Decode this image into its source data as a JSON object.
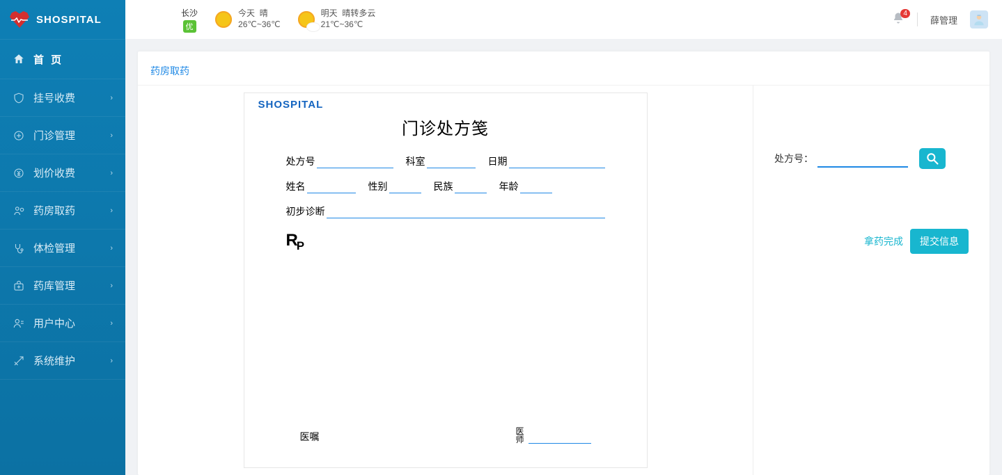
{
  "brand": "SHOSPITAL",
  "sidebar": {
    "home": "首 页",
    "items": [
      {
        "icon": "shield-icon",
        "label": "挂号收费"
      },
      {
        "icon": "plus-icon",
        "label": "门诊管理"
      },
      {
        "icon": "yuan-icon",
        "label": "划价收费"
      },
      {
        "icon": "pharmacy-icon",
        "label": "药房取药"
      },
      {
        "icon": "stethoscope-icon",
        "label": "体检管理"
      },
      {
        "icon": "medkit-icon",
        "label": "药库管理"
      },
      {
        "icon": "user-icon",
        "label": "用户中心"
      },
      {
        "icon": "tools-icon",
        "label": "系统维护"
      }
    ]
  },
  "header": {
    "city": "长沙",
    "aqi": "优",
    "today": {
      "label": "今天",
      "cond": "晴",
      "temp": "26℃~36℃"
    },
    "tomorrow": {
      "label": "明天",
      "cond": "晴转多云",
      "temp": "21℃~36℃"
    },
    "notification_count": "4",
    "user": "薛管理"
  },
  "panel_title": "药房取药",
  "rx": {
    "brand": "SHOSPITAL",
    "title": "门诊处方笺",
    "px_no_label": "处方号",
    "dept_label": "科室",
    "date_label": "日期",
    "name_label": "姓名",
    "sex_label": "性别",
    "nation_label": "民族",
    "age_label": "年龄",
    "dx_label": "初步诊断",
    "rp": "R",
    "rp_sub": "P",
    "advice_label": "医嘱",
    "doctor_label_top": "医",
    "doctor_label_bottom": "师"
  },
  "right": {
    "search_label": "处方号：",
    "done_label": "拿药完成",
    "submit_label": "提交信息"
  }
}
